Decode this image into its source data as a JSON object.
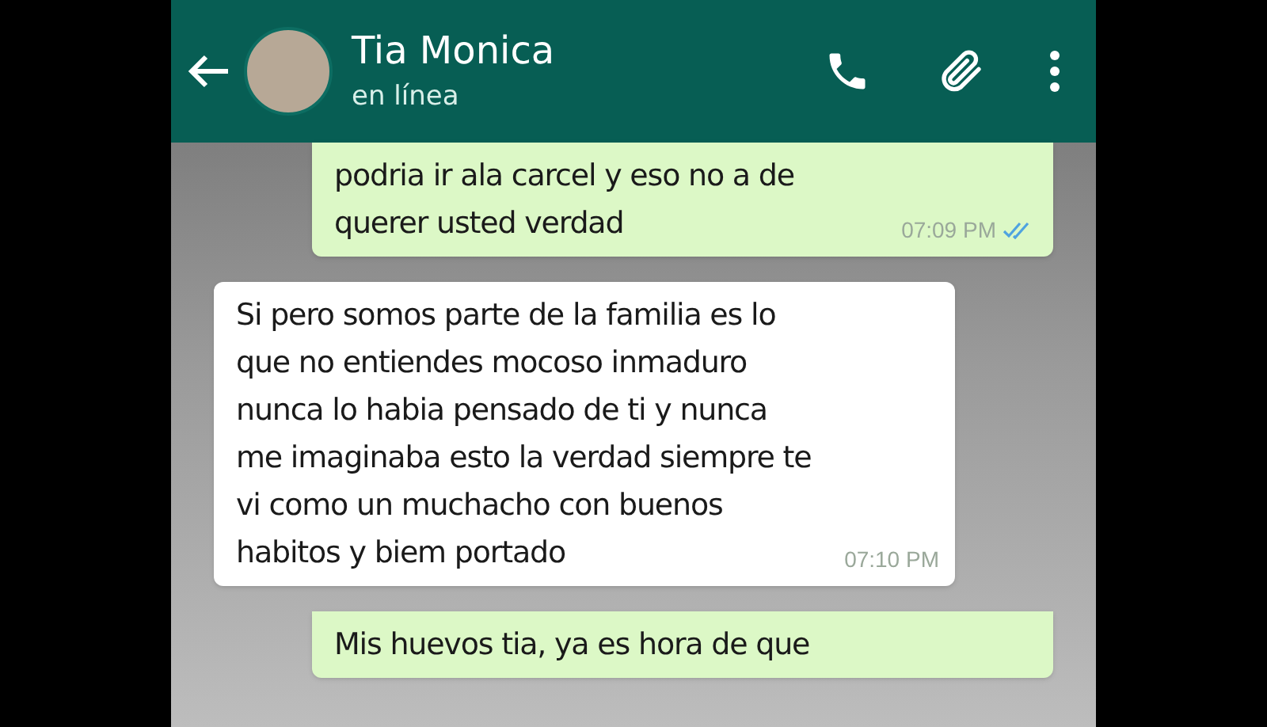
{
  "header": {
    "contact_name": "Tia Monica",
    "status": "en línea"
  },
  "messages": [
    {
      "kind": "outgoing",
      "lines": [
        "podria ir ala carcel y eso no a de",
        "querer usted verdad"
      ],
      "time": "07:09 PM",
      "read": true
    },
    {
      "kind": "incoming",
      "lines": [
        "Si pero somos parte de la familia es lo",
        "que no entiendes mocoso inmaduro",
        "nunca lo habia pensado de ti y nunca",
        "me imaginaba esto la verdad siempre te",
        "vi como un muchacho con buenos",
        "habitos y biem portado"
      ],
      "time": "07:10 PM"
    },
    {
      "kind": "outgoing",
      "lines": [
        "Mis huevos tia, ya es hora de que"
      ]
    }
  ]
}
